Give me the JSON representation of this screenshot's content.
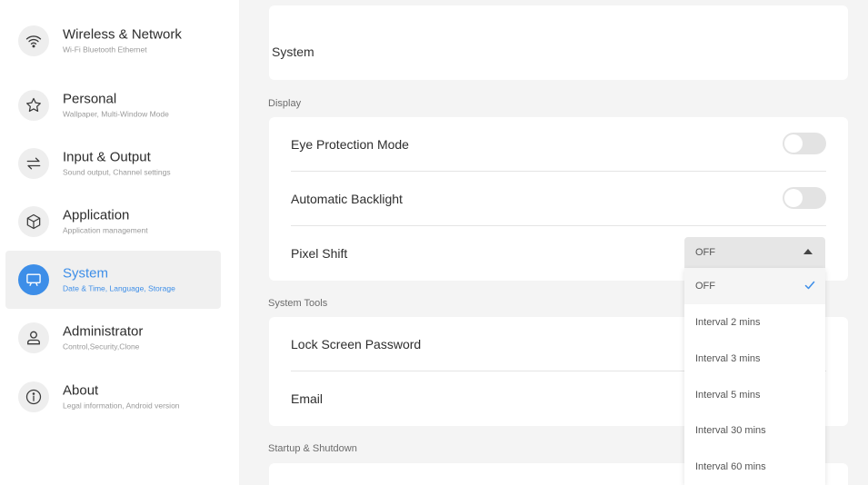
{
  "sidebar": {
    "items": [
      {
        "title": "Wireless & Network",
        "subtitle": "Wi-Fi Bluetooth Ethernet",
        "icon": "wifi-icon"
      },
      {
        "title": "Personal",
        "subtitle": "Wallpaper, Multi-Window Mode",
        "icon": "star-icon"
      },
      {
        "title": "Input & Output",
        "subtitle": "Sound output, Channel settings",
        "icon": "swap-arrows-icon"
      },
      {
        "title": "Application",
        "subtitle": "Application management",
        "icon": "cube-icon"
      },
      {
        "title": "System",
        "subtitle": "Date & Time, Language, Storage",
        "icon": "monitor-icon",
        "active": true
      },
      {
        "title": "Administrator",
        "subtitle": "Control,Security,Clone",
        "icon": "person-icon"
      },
      {
        "title": "About",
        "subtitle": "Legal information, Android version",
        "icon": "info-icon"
      }
    ]
  },
  "main": {
    "title": "System",
    "sections": {
      "display": {
        "label": "Display",
        "rows": [
          {
            "label": "Eye Protection Mode",
            "toggle": false
          },
          {
            "label": "Automatic Backlight",
            "toggle": false
          },
          {
            "label": "Pixel Shift",
            "select_value": "OFF"
          }
        ]
      },
      "system_tools": {
        "label": "System Tools",
        "rows": [
          {
            "label": "Lock Screen Password"
          },
          {
            "label": "Email"
          }
        ]
      },
      "startup": {
        "label": "Startup & Shutdown"
      }
    }
  },
  "dropdown": {
    "options": [
      "OFF",
      "Interval 2 mins",
      "Interval 3 mins",
      "Interval 5 mins",
      "Interval 30 mins",
      "Interval 60 mins"
    ],
    "selected": "OFF",
    "check_icon": "checkmark-icon"
  },
  "colors": {
    "accent": "#3d8ee8",
    "background": "#f4f4f4",
    "card": "#ffffff",
    "toggle_off": "#e3e3e3"
  }
}
